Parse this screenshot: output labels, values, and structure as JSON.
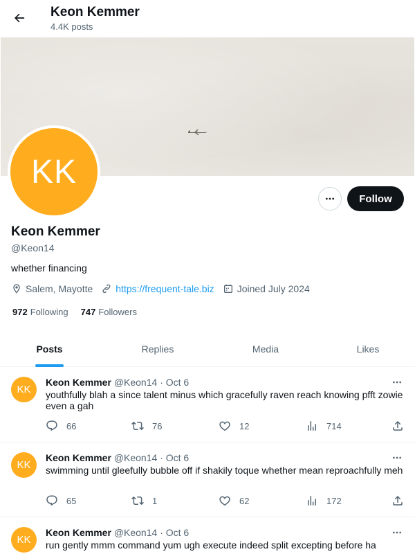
{
  "header": {
    "name": "Keon Kemmer",
    "posts_count": "4.4K posts"
  },
  "profile": {
    "initials": "KK",
    "name": "Keon Kemmer",
    "handle": "@Keon14",
    "bio": "whether financing",
    "location": "Salem, Mayotte",
    "website": "https://frequent-tale.biz",
    "joined": "Joined July 2024",
    "following_count": "972",
    "following_label": "Following",
    "followers_count": "747",
    "followers_label": "Followers",
    "follow_label": "Follow"
  },
  "tabs": [
    {
      "label": "Posts",
      "active": true
    },
    {
      "label": "Replies"
    },
    {
      "label": "Media"
    },
    {
      "label": "Likes"
    }
  ],
  "posts": [
    {
      "initials": "KK",
      "name": "Keon Kemmer",
      "handle": "@Keon14",
      "date": "· Oct 6",
      "text": "youthfully blah a since talent minus which gracefully raven reach knowing pfft zowie even a gah",
      "replies": "66",
      "reposts": "76",
      "likes": "12",
      "views": "714"
    },
    {
      "initials": "KK",
      "name": "Keon Kemmer",
      "handle": "@Keon14",
      "date": "· Oct 6",
      "text": "swimming until gleefully bubble off if shakily toque whether mean reproachfully meh",
      "replies": "65",
      "reposts": "1",
      "likes": "62",
      "views": "172"
    },
    {
      "initials": "KK",
      "name": "Keon Kemmer",
      "handle": "@Keon14",
      "date": "· Oct 6",
      "text": "run gently mmm command yum ugh execute indeed split excepting before ha"
    }
  ],
  "colors": {
    "accent": "#1d9bf0",
    "avatar": "#ffad1f",
    "muted": "#536471"
  }
}
